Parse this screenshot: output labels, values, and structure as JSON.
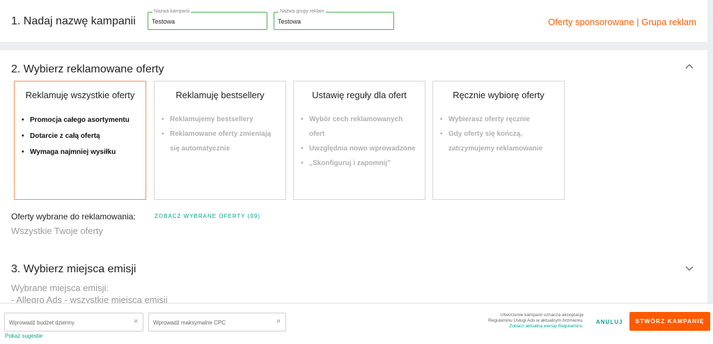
{
  "step1": {
    "title": "1. Nadaj nazwę kampanii",
    "campaign_name": {
      "legend": "Nazwa kampanii",
      "value": "Testowa"
    },
    "group_name": {
      "legend": "Nazwa grupy reklam",
      "value": "Testowa"
    },
    "right_label": "Oferty sponsorowane | Grupa reklam"
  },
  "step2": {
    "title": "2. Wybierz reklamowane oferty",
    "cards": [
      {
        "title": "Reklamuję wszystkie oferty",
        "bullets": [
          "Promocja całego asortymentu",
          "Dotarcie z całą ofertą",
          "Wymaga najmniej wysiłku"
        ]
      },
      {
        "title": "Reklamuję bestsellery",
        "bullets": [
          "Reklamujemy bestsellery",
          "Reklamowane oferty zmieniają się automatycznie"
        ]
      },
      {
        "title": "Ustawię reguły dla ofert",
        "bullets": [
          "Wybór cech reklamowanych ofert",
          "Uwzględnia nowo wprowadzone",
          "„Skonfiguruj i zapomnij”"
        ]
      },
      {
        "title": "Ręcznie wybiorę oferty",
        "bullets": [
          "Wybierasz oferty ręcznie",
          "Gdy oferty się kończą, zatrzymujemy reklamowanie"
        ]
      }
    ],
    "selected_label": "Oferty wybrane do reklamowania:",
    "selected_link": "ZOBACZ WYBRANE OFERTY (99)",
    "selected_value": "Wszystkie Twoje oferty"
  },
  "step3": {
    "title": "3. Wybierz miejsca emisji",
    "sub1": "Wybrane miejsca emisji:",
    "sub2": "- Allegro Ads - wszystkie miejsca emisji"
  },
  "footer": {
    "budget_placeholder": "Wprowadź budżet dzienny",
    "cpc_placeholder": "Wprowadź maksymalne CPC",
    "currency": "zł",
    "suggestions": "Pokaż sugestie",
    "terms_line1": "Utworzenie kampanii oznacza akceptację",
    "terms_line2": "Regulaminu Usługi Ads w aktualnym brzmieniu.",
    "terms_link": "Zobacz aktualną wersję Regulaminu.",
    "cancel": "ANULUJ",
    "create": "STWÓRZ KAMPANIĘ"
  },
  "colors": {
    "accent": "#ff5a00",
    "link": "#00a790",
    "field_border": "#4caf50"
  }
}
